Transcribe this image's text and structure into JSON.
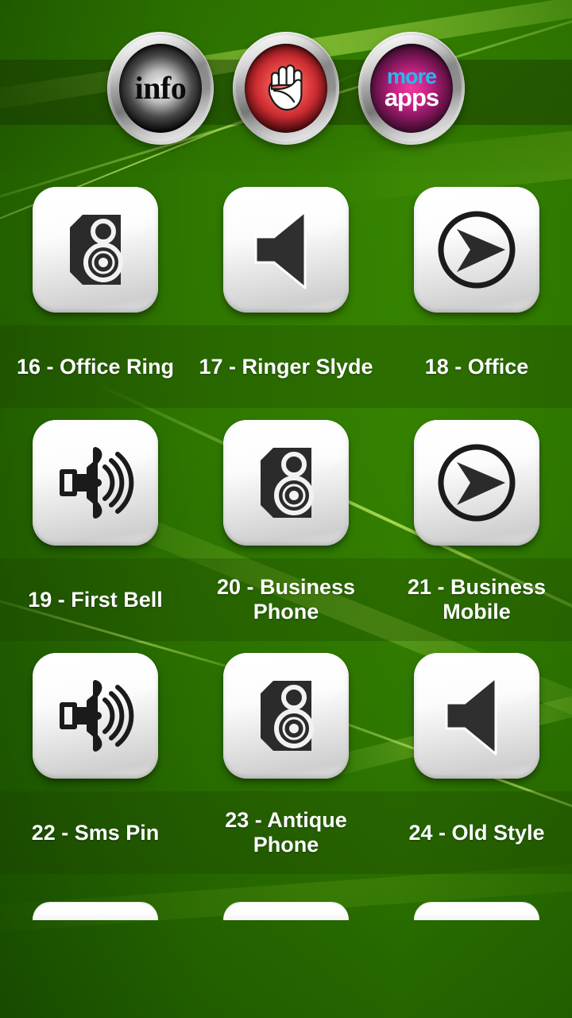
{
  "header": {
    "buttons": [
      {
        "id": "info",
        "label": "info",
        "icon": "info-button",
        "face_color": "#4a4a4a"
      },
      {
        "id": "stop",
        "label": "",
        "icon": "hand-stop-icon",
        "face_color": "#c92b30"
      },
      {
        "id": "more",
        "label_top": "more",
        "label_bottom": "apps",
        "icon": "more-apps-button",
        "face_color": "#c42283",
        "color_top": "#2ab7f0",
        "color_bottom": "#ffffff"
      }
    ]
  },
  "theme": {
    "background_green": "#6fb00b",
    "header_band": "#3d5f06",
    "caption_overlay": "rgba(26,58,0,0.26)",
    "tile_face": "#f4f4f4",
    "icon_dark": "#2b2b2b"
  },
  "grid": {
    "columns": 3,
    "items": [
      {
        "number": "16",
        "name": "Office Ring",
        "label": "16 - Office Ring",
        "icon": "speaker-cabinet-icon"
      },
      {
        "number": "17",
        "name": "Ringer Slyde",
        "label": "17 - Ringer Slyde",
        "icon": "volume-cone-icon"
      },
      {
        "number": "18",
        "name": "Office",
        "label": "18 - Office",
        "icon": "play-arrow-circle-icon"
      },
      {
        "number": "19",
        "name": "First Bell",
        "label": "19 - First Bell",
        "icon": "horn-waves-icon"
      },
      {
        "number": "20",
        "name": "Business Phone",
        "label": "20 - Business Phone",
        "icon": "speaker-cabinet-icon"
      },
      {
        "number": "21",
        "name": "Business Mobile",
        "label": "21 - Business Mobile",
        "icon": "play-arrow-circle-icon"
      },
      {
        "number": "22",
        "name": "Sms Pin",
        "label": "22 - Sms Pin",
        "icon": "horn-waves-icon"
      },
      {
        "number": "23",
        "name": "Antique Phone",
        "label": "23 - Antique Phone",
        "icon": "speaker-cabinet-icon"
      },
      {
        "number": "24",
        "name": "Old Style",
        "label": "24 - Old Style",
        "icon": "volume-cone-icon"
      }
    ]
  }
}
